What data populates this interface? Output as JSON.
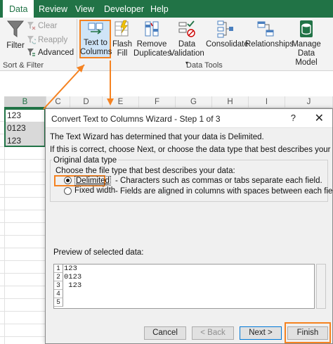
{
  "ribbon": {
    "tabs": [
      "Data",
      "Review",
      "View",
      "Developer",
      "Help"
    ],
    "active_tab": "Data",
    "filter": "Filter",
    "clear": "Clear",
    "reapply": "Reapply",
    "advanced": "Advanced",
    "sort_filter_group": "Sort & Filter",
    "text_to_columns_1": "Text to",
    "text_to_columns_2": "Columns",
    "flash_fill_1": "Flash",
    "flash_fill_2": "Fill",
    "remove_duplicates_1": "Remove",
    "remove_duplicates_2": "Duplicates",
    "data_validation_1": "Data",
    "data_validation_2": "Validation",
    "consolidate": "Consolidate",
    "relationships": "Relationships",
    "manage_model_1": "Manage",
    "manage_model_2": "Data Model",
    "data_tools_group": "Data Tools"
  },
  "sheet": {
    "columns": [
      "B",
      "C",
      "D",
      "E",
      "F",
      "G",
      "H",
      "I",
      "J"
    ],
    "selected_column": "B",
    "cells": [
      "123",
      "0123",
      "123"
    ]
  },
  "dialog": {
    "title": "Convert Text to Columns Wizard - Step 1 of 3",
    "help": "?",
    "close": "✕",
    "line1": "The Text Wizard has determined that your data is Delimited.",
    "line2": "If this is correct, choose Next, or choose the data type that best describes your data.",
    "section": "Original data type",
    "prompt": "Choose the file type that best describes your data:",
    "option_delimited": "Delimited",
    "option_delimited_desc": "- Characters such as commas or tabs separate each field.",
    "option_fixed": "Fixed width",
    "option_fixed_desc": "- Fields are aligned in columns with spaces between each field.",
    "preview_label": "Preview of selected data:",
    "preview_rows": [
      {
        "num": "1",
        "text": "123"
      },
      {
        "num": "2",
        "text": "0123"
      },
      {
        "num": "3",
        "text": " 123"
      },
      {
        "num": "4",
        "text": ""
      },
      {
        "num": "5",
        "text": ""
      }
    ],
    "cancel": "Cancel",
    "back": "< Back",
    "next": "Next >",
    "finish": "Finish"
  },
  "colors": {
    "accent": "#217346",
    "highlight": "#f58220",
    "button_focus": "#0078d7"
  }
}
